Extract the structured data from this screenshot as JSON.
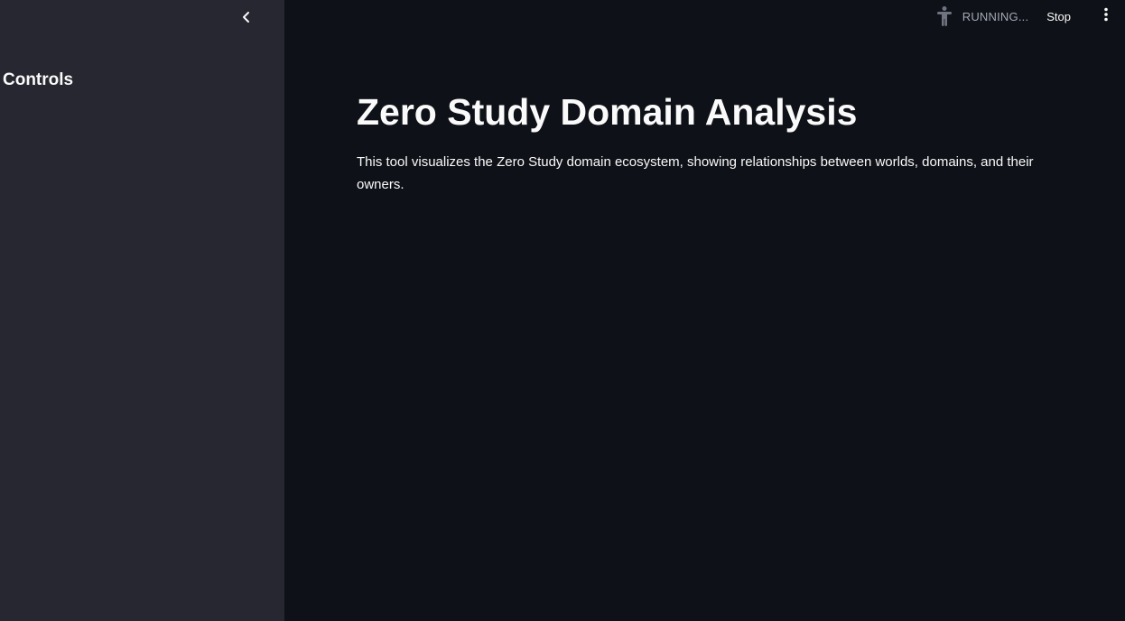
{
  "sidebar": {
    "title": "Controls",
    "collapse_icon": "chevron-left-icon"
  },
  "header": {
    "status_icon": "accessibility-person-icon",
    "status_text": "RUNNING...",
    "stop_label": "Stop",
    "menu_icon": "vertical-ellipsis-icon"
  },
  "main": {
    "title": "Zero Study Domain Analysis",
    "description": "This tool visualizes the Zero Study domain ecosystem, showing relationships between worlds, domains, and their owners."
  },
  "colors": {
    "app_background": "#0e1117",
    "sidebar_background": "#262730",
    "text": "#fafafa",
    "muted_text": "#a3a8b4"
  }
}
